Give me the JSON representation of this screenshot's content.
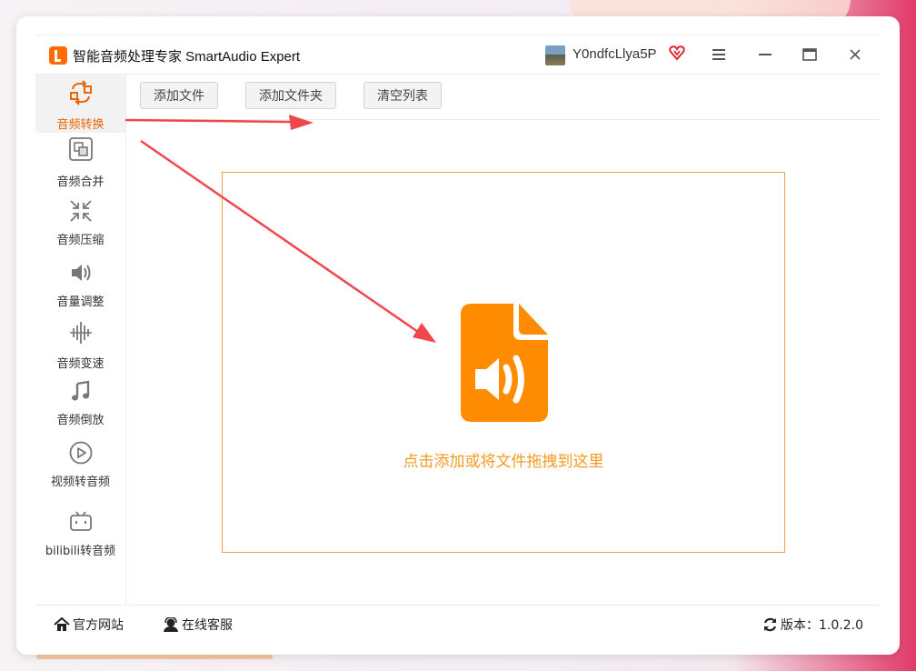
{
  "app": {
    "title": "智能音频处理专家 SmartAudio Expert",
    "username": "Y0ndfcLlya5P",
    "accent": "#ff8c00"
  },
  "window_controls": [
    "menu-icon",
    "minimize-icon",
    "maximize-icon",
    "close-icon"
  ],
  "sidebar": {
    "items": [
      {
        "label": "音频转换",
        "icon": "convert-icon",
        "active": true
      },
      {
        "label": "音频合并",
        "icon": "merge-icon",
        "active": false
      },
      {
        "label": "音频压缩",
        "icon": "compress-icon",
        "active": false
      },
      {
        "label": "音量调整",
        "icon": "volume-icon",
        "active": false
      },
      {
        "label": "音频变速",
        "icon": "speed-icon",
        "active": false
      },
      {
        "label": "音频倒放",
        "icon": "music-note-icon",
        "active": false
      },
      {
        "label": "视频转音频",
        "icon": "play-circle-icon",
        "active": false
      },
      {
        "label": "bilibili转音频",
        "icon": "bilibili-icon",
        "active": false
      }
    ]
  },
  "toolbar": {
    "add_file": "添加文件",
    "add_folder": "添加文件夹",
    "clear_list": "清空列表"
  },
  "dropzone": {
    "hint": "点击添加或将文件拖拽到这里",
    "icon": "audio-file-icon",
    "color": "#ff8c00"
  },
  "footer": {
    "website": "官方网站",
    "support": "在线客服",
    "version_label": "版本：1.0.2.0"
  },
  "annotations": {
    "arrow_color": "#f0474c"
  }
}
